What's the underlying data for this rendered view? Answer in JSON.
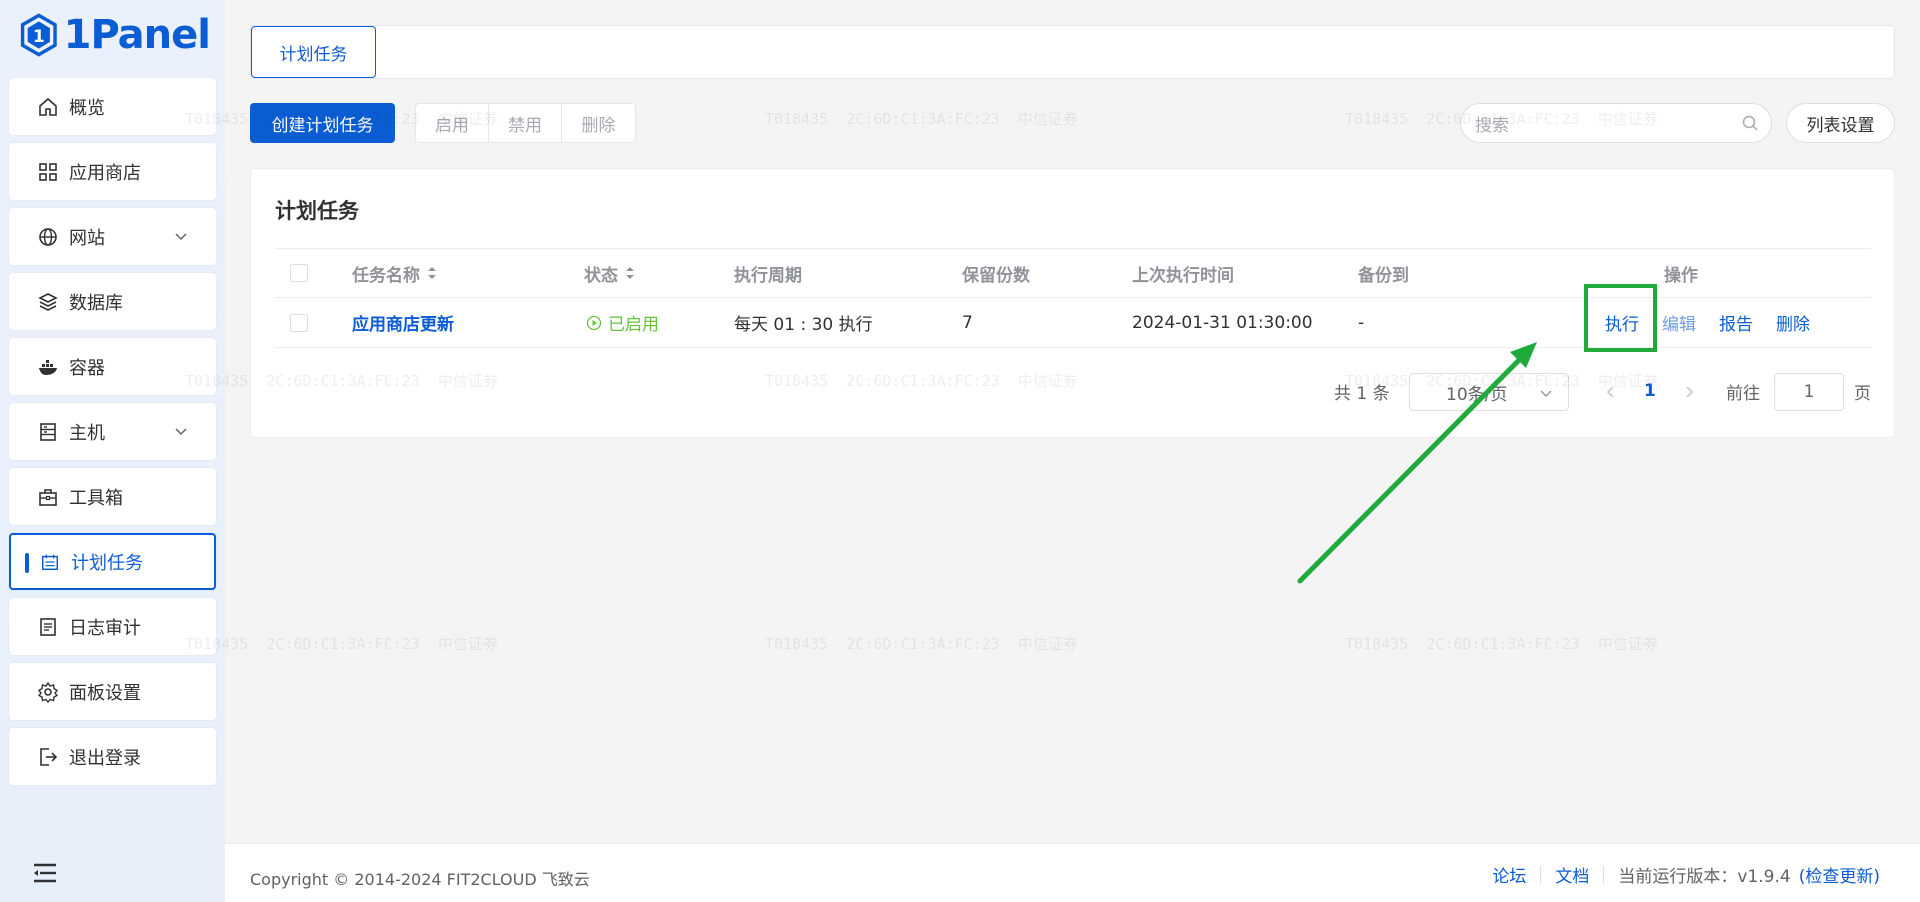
{
  "brand": {
    "name": "1Panel",
    "color": "#0b5dd3"
  },
  "sidebar": {
    "items": [
      {
        "label": "概览",
        "icon": "home-icon",
        "has_chevron": false
      },
      {
        "label": "应用商店",
        "icon": "grid-icon",
        "has_chevron": false
      },
      {
        "label": "网站",
        "icon": "globe-icon",
        "has_chevron": true
      },
      {
        "label": "数据库",
        "icon": "layers-icon",
        "has_chevron": false
      },
      {
        "label": "容器",
        "icon": "docker-icon",
        "has_chevron": false
      },
      {
        "label": "主机",
        "icon": "server-icon",
        "has_chevron": true
      },
      {
        "label": "工具箱",
        "icon": "toolbox-icon",
        "has_chevron": false
      },
      {
        "label": "计划任务",
        "icon": "calendar-icon",
        "has_chevron": false,
        "active": true
      },
      {
        "label": "日志审计",
        "icon": "log-icon",
        "has_chevron": false
      },
      {
        "label": "面板设置",
        "icon": "gear-icon",
        "has_chevron": false
      },
      {
        "label": "退出登录",
        "icon": "logout-icon",
        "has_chevron": false
      }
    ]
  },
  "tabs": [
    {
      "label": "计划任务",
      "active": true
    }
  ],
  "toolbar": {
    "create_label": "创建计划任务",
    "enable_label": "启用",
    "disable_label": "禁用",
    "delete_label": "删除",
    "search_placeholder": "搜索",
    "column_settings_label": "列表设置"
  },
  "card": {
    "title": "计划任务",
    "columns": [
      "任务名称",
      "状态",
      "执行周期",
      "保留份数",
      "上次执行时间",
      "备份到",
      "操作"
    ],
    "rows": [
      {
        "name": "应用商店更新",
        "status": "已启用",
        "schedule": "每天  01 : 30 执行",
        "retain": "7",
        "last_run": "2024-01-31 01:30:00",
        "backup_to": "-",
        "actions": {
          "run": "执行",
          "edit": "编辑",
          "report": "报告",
          "delete": "删除"
        }
      }
    ]
  },
  "pagination": {
    "total_text": "共 1 条",
    "page_size": "10条/页",
    "current_page": "1",
    "goto_label": "前往",
    "goto_value": "1",
    "page_suffix": "页"
  },
  "footer": {
    "copyright": "Copyright © 2014-2024 FIT2CLOUD 飞致云",
    "forum": "论坛",
    "docs": "文档",
    "version_label": "当前运行版本：v1.9.4",
    "check_update": "(检查更新)"
  },
  "watermark": {
    "text": "T018435  2C:6D:C1:3A:FC:23  中信证券"
  },
  "colors": {
    "primary": "#0b5dd3",
    "success": "#67c23a",
    "annotation_green": "#1faa3b"
  }
}
